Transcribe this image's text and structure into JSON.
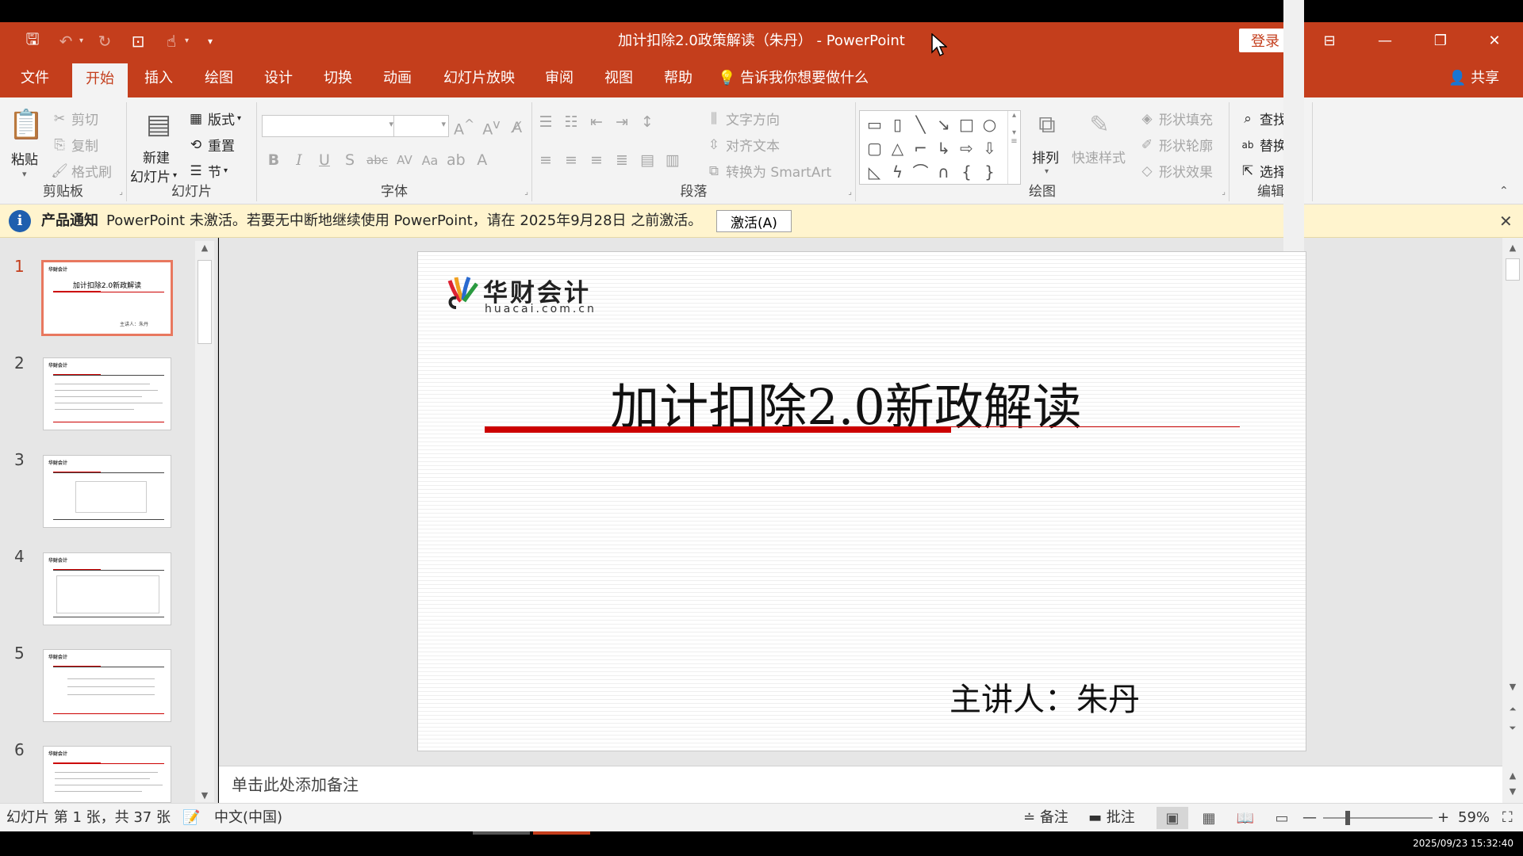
{
  "window": {
    "title": "加计扣除2.0政策解读（朱丹） - PowerPoint",
    "login": "登录"
  },
  "tabs": [
    "文件",
    "开始",
    "插入",
    "绘图",
    "设计",
    "切换",
    "动画",
    "幻灯片放映",
    "审阅",
    "视图",
    "帮助"
  ],
  "tellme": "告诉我你想要做什么",
  "share": "共享",
  "ribbon": {
    "clipboard": {
      "name": "剪贴板",
      "paste": "粘贴",
      "cut": "剪切",
      "copy": "复制",
      "format_painter": "格式刷"
    },
    "slides": {
      "name": "幻灯片",
      "new_slide_1": "新建",
      "new_slide_2": "幻灯片",
      "layout": "版式",
      "reset": "重置",
      "section": "节"
    },
    "font": {
      "name": "字体"
    },
    "paragraph": {
      "name": "段落",
      "text_direction": "文字方向",
      "align_text": "对齐文本",
      "smartart": "转换为 SmartArt"
    },
    "drawing": {
      "name": "绘图",
      "arrange": "排列",
      "quick_styles": "快速样式",
      "shape_fill": "形状填充",
      "shape_outline": "形状轮廓",
      "shape_effects": "形状效果"
    },
    "editing": {
      "name": "编辑",
      "find": "查找",
      "replace": "替换",
      "select": "选择"
    }
  },
  "notice": {
    "title": "产品通知",
    "text": "PowerPoint 未激活。若要无中断地继续使用 PowerPoint，请在 2025年9月28日 之前激活。",
    "button": "激活(A)"
  },
  "thumbnails": {
    "numbers": [
      "1",
      "2",
      "3",
      "4",
      "5",
      "6"
    ],
    "slide1_title": "加计扣除2.0新政解读",
    "slide1_footer": "主讲人：朱丹"
  },
  "slide": {
    "logo_cn": "华财会计",
    "logo_en": "huacai.com.cn",
    "title": "加计扣除2.0新政解读",
    "speaker": "主讲人：朱丹"
  },
  "notes_placeholder": "单击此处添加备注",
  "status": {
    "slide_info": "幻灯片 第 1 张，共 37 张",
    "language": "中文(中国)",
    "notes": "备注",
    "comments": "批注",
    "zoom": "59%"
  },
  "taskbar": {
    "clock": "2025/09/23 15:32:40"
  },
  "colors": {
    "accent": "#c43e1c",
    "ribbon_bg": "#f3f3f3",
    "notice_bg": "#fff4ce",
    "slide_red": "#cc0000"
  }
}
